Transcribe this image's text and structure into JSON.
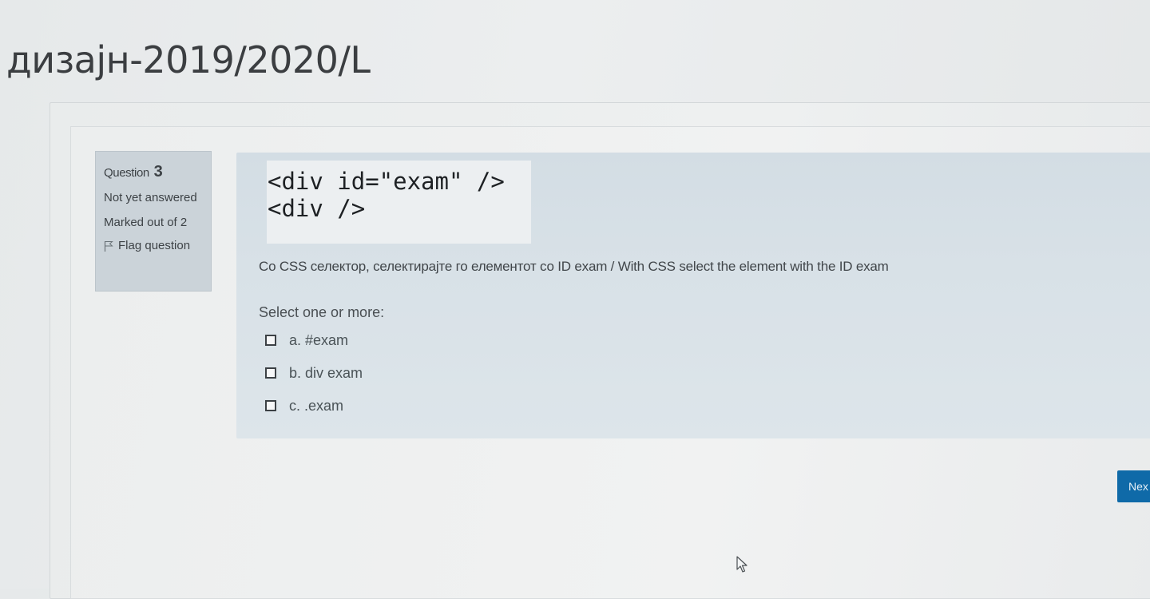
{
  "page": {
    "title": "дизајн-2019/2020/L"
  },
  "question_info": {
    "question_label": "Question",
    "question_number": "3",
    "state": "Not yet answered",
    "marks": "Marked out of 2",
    "flag_label": "Flag question",
    "flag_icon": "flag-icon"
  },
  "question": {
    "code_lines": [
      "<div id=\"exam\" />",
      "<div />"
    ],
    "text": "Со CSS селектор, селектирајте го елементот со ID exam / With CSS select the element with the ID exam",
    "prompt": "Select one or more:",
    "answers": [
      {
        "label": "a. #exam",
        "checked": false
      },
      {
        "label": "b. div exam",
        "checked": false
      },
      {
        "label": "c. .exam",
        "checked": false
      }
    ]
  },
  "navigation": {
    "next_label": "Nex"
  },
  "colors": {
    "info_panel": "#cbd3d9",
    "content_panel": "#d8e1e7",
    "primary_button": "#0f6aa8"
  }
}
